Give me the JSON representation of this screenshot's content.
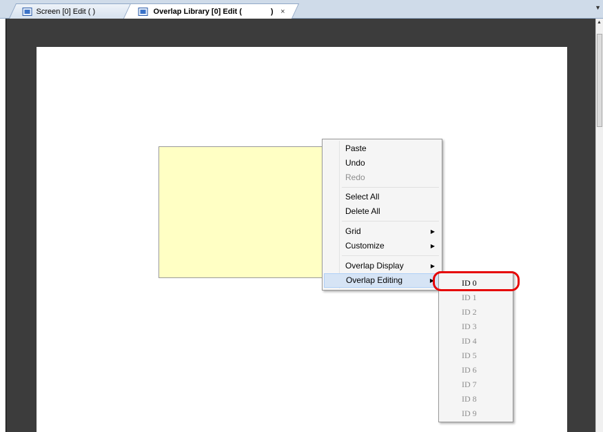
{
  "tabs": [
    {
      "label": "Screen [0] Edit (          )",
      "icon": "screen-edit-icon"
    },
    {
      "label": "Overlap Library [0] Edit (",
      "suffix": ")",
      "close": "×",
      "icon": "overlap-library-icon"
    }
  ],
  "context_menu": {
    "items": [
      {
        "label": "Paste",
        "enabled": true
      },
      {
        "label": "Undo",
        "enabled": true
      },
      {
        "label": "Redo",
        "enabled": false
      },
      {
        "label": "Select All",
        "enabled": true
      },
      {
        "label": "Delete All",
        "enabled": true
      },
      {
        "label": "Grid",
        "enabled": true,
        "submenu": true
      },
      {
        "label": "Customize",
        "enabled": true,
        "submenu": true
      },
      {
        "label": "Overlap Display",
        "enabled": true,
        "submenu": true
      },
      {
        "label": "Overlap Editing",
        "enabled": true,
        "submenu": true,
        "highlighted": true
      }
    ],
    "arrow": "▶"
  },
  "submenu": {
    "items": [
      {
        "label": "ID 0",
        "enabled": true
      },
      {
        "label": "ID 1",
        "enabled": false
      },
      {
        "label": "ID 2",
        "enabled": false
      },
      {
        "label": "ID 3",
        "enabled": false
      },
      {
        "label": "ID 4",
        "enabled": false
      },
      {
        "label": "ID 5",
        "enabled": false
      },
      {
        "label": "ID 6",
        "enabled": false
      },
      {
        "label": "ID 7",
        "enabled": false
      },
      {
        "label": "ID 8",
        "enabled": false
      },
      {
        "label": "ID 9",
        "enabled": false
      }
    ]
  },
  "colors": {
    "overlap_fill": "#ffffc4",
    "highlight": "#e60000",
    "editor_bg": "#3c3c3c"
  }
}
